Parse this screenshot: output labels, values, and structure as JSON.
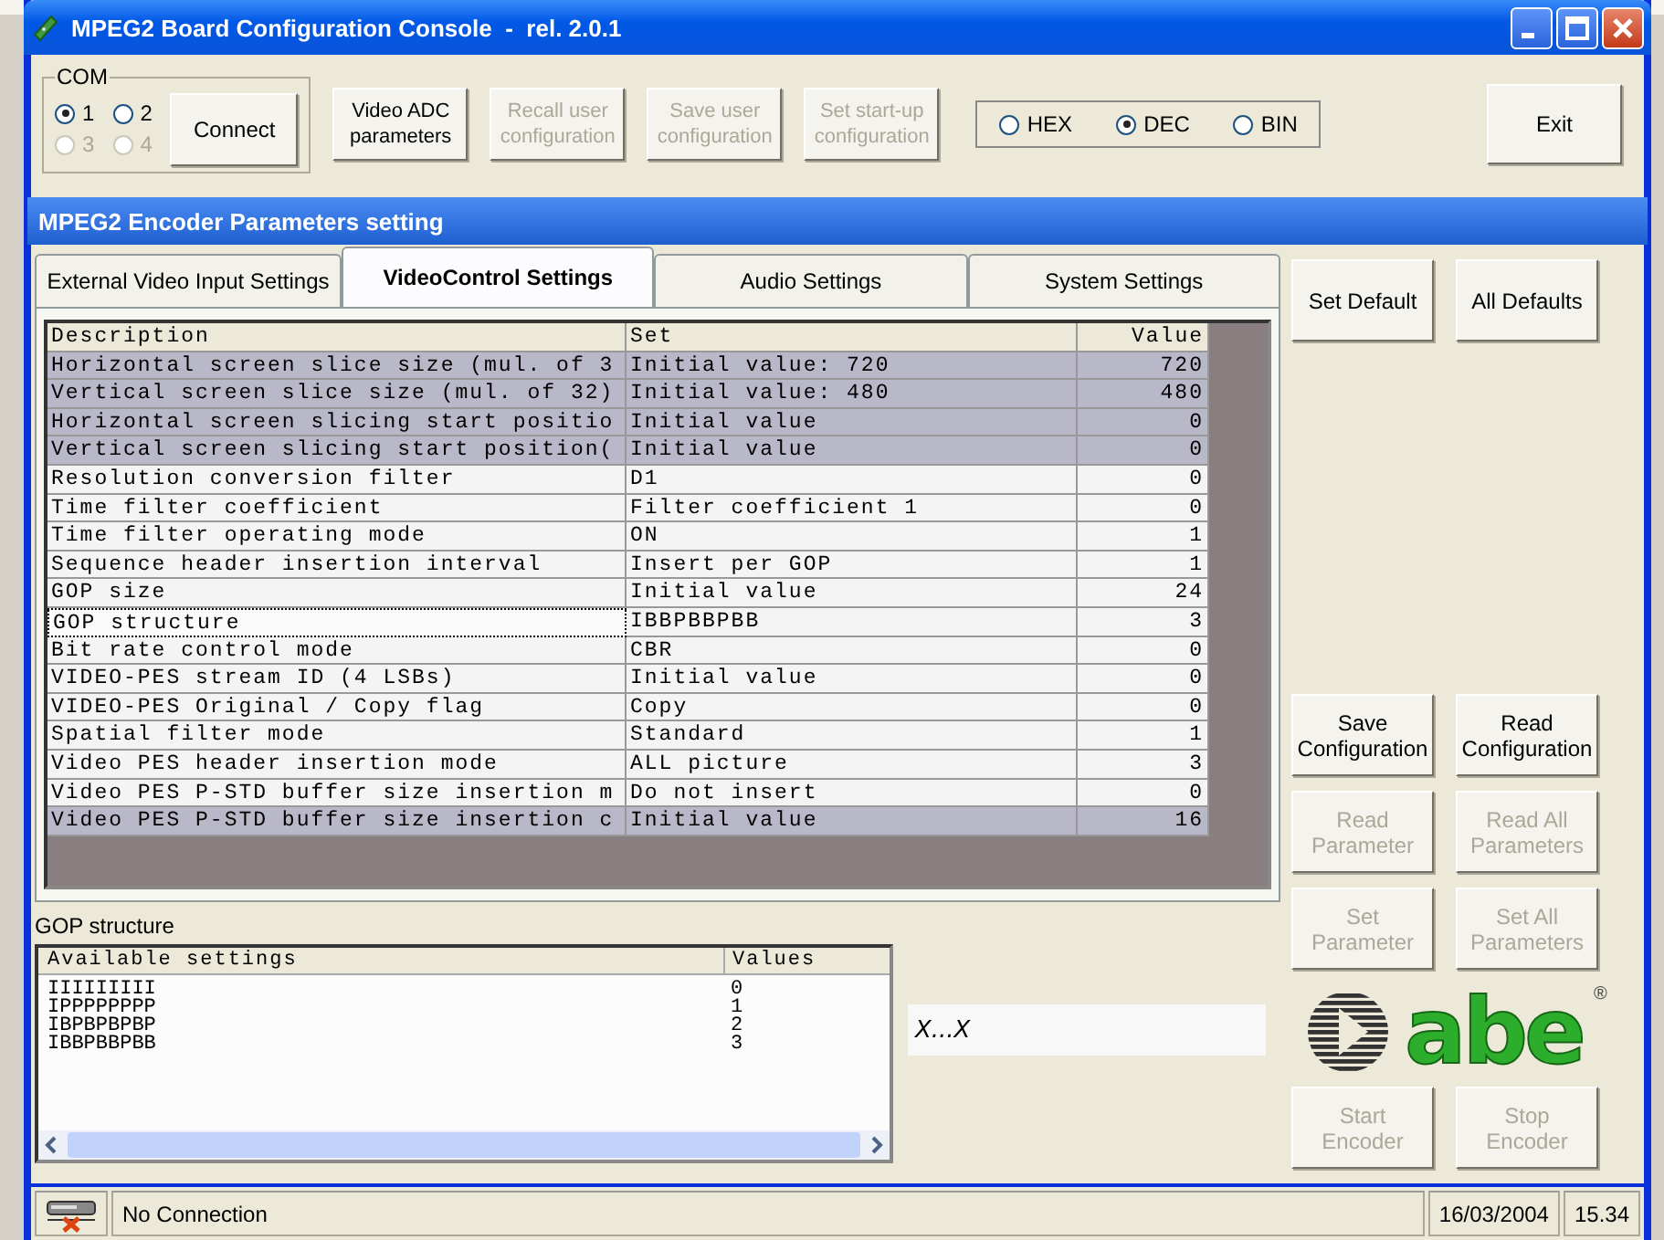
{
  "window": {
    "title": "MPEG2 Board Configuration Console  -  rel. 2.0.1"
  },
  "com": {
    "label": "COM",
    "ports": [
      {
        "label": "1",
        "selected": true,
        "disabled": false
      },
      {
        "label": "2",
        "selected": false,
        "disabled": false
      },
      {
        "label": "3",
        "selected": false,
        "disabled": true
      },
      {
        "label": "4",
        "selected": false,
        "disabled": true
      }
    ]
  },
  "toolbar_buttons": [
    {
      "label": "Connect",
      "disabled": false
    },
    {
      "label": "Video ADC parameters",
      "disabled": false
    },
    {
      "label": "Recall user configuration",
      "disabled": true
    },
    {
      "label": "Save user configuration",
      "disabled": true
    },
    {
      "label": "Set start-up configuration",
      "disabled": true
    }
  ],
  "format": [
    {
      "label": "HEX",
      "selected": false
    },
    {
      "label": "DEC",
      "selected": true
    },
    {
      "label": "BIN",
      "selected": false
    }
  ],
  "exit_button": "Exit",
  "inner_window": {
    "title": "MPEG2 Encoder Parameters setting"
  },
  "tabs": [
    {
      "label": "External Video Input Settings",
      "selected": false
    },
    {
      "label": "VideoControl Settings",
      "selected": true
    },
    {
      "label": "Audio Settings",
      "selected": false
    },
    {
      "label": "System Settings",
      "selected": false
    }
  ],
  "table": {
    "columns": [
      "Description",
      "Set",
      "Value"
    ],
    "rows": [
      {
        "cells": [
          "Horizontal screen slice size (mul. of 3",
          "Initial value: 720",
          "720"
        ],
        "selected": true,
        "focused": false
      },
      {
        "cells": [
          "Vertical screen slice size (mul. of 32)",
          "Initial value: 480",
          "480"
        ],
        "selected": true,
        "focused": false
      },
      {
        "cells": [
          "Horizontal screen slicing start positio",
          "Initial value",
          "0"
        ],
        "selected": true,
        "focused": false
      },
      {
        "cells": [
          "Vertical screen slicing start position(",
          "Initial value",
          "0"
        ],
        "selected": true,
        "focused": false
      },
      {
        "cells": [
          "Resolution conversion filter",
          "D1",
          "0"
        ],
        "selected": false,
        "focused": false
      },
      {
        "cells": [
          "Time filter coefficient",
          "Filter coefficient 1",
          "0"
        ],
        "selected": false,
        "focused": false
      },
      {
        "cells": [
          "Time filter operating mode",
          "ON",
          "1"
        ],
        "selected": false,
        "focused": false
      },
      {
        "cells": [
          "Sequence header insertion interval",
          "Insert per GOP",
          "1"
        ],
        "selected": false,
        "focused": false
      },
      {
        "cells": [
          "GOP size",
          "Initial value",
          "24"
        ],
        "selected": false,
        "focused": false
      },
      {
        "cells": [
          "GOP structure",
          "IBBPBBPBB",
          "3"
        ],
        "selected": false,
        "focused": true
      },
      {
        "cells": [
          "Bit rate control mode",
          "CBR",
          "0"
        ],
        "selected": false,
        "focused": false
      },
      {
        "cells": [
          "VIDEO-PES stream ID (4 LSBs)",
          "Initial value",
          "0"
        ],
        "selected": false,
        "focused": false
      },
      {
        "cells": [
          "VIDEO-PES Original / Copy flag",
          "Copy",
          "0"
        ],
        "selected": false,
        "focused": false
      },
      {
        "cells": [
          "Spatial filter mode",
          "Standard",
          "1"
        ],
        "selected": false,
        "focused": false
      },
      {
        "cells": [
          "Video PES header insertion mode",
          "ALL picture",
          "3"
        ],
        "selected": false,
        "focused": false
      },
      {
        "cells": [
          "Video PES P-STD buffer size insertion m",
          "Do not insert",
          "0"
        ],
        "selected": false,
        "focused": false
      },
      {
        "cells": [
          "Video PES P-STD buffer size insertion c",
          "Initial value",
          "16"
        ],
        "selected": true,
        "focused": false
      }
    ]
  },
  "side_buttons": [
    {
      "label": "Set Default",
      "disabled": false
    },
    {
      "label": "All Defaults",
      "disabled": false
    },
    {
      "label": "Save Configuration",
      "disabled": false
    },
    {
      "label": "Read Configuration",
      "disabled": false
    },
    {
      "label": "Read Parameter",
      "disabled": true
    },
    {
      "label": "Read All Parameters",
      "disabled": true
    },
    {
      "label": "Set Parameter",
      "disabled": true
    },
    {
      "label": "Set All Parameters",
      "disabled": true
    }
  ],
  "logo": {
    "text": "abe",
    "mark": "®"
  },
  "encoder_buttons": [
    {
      "label": "Start Encoder",
      "disabled": true
    },
    {
      "label": "Stop Encoder",
      "disabled": true
    }
  ],
  "gop": {
    "label": "GOP structure",
    "columns": [
      "Available settings",
      "Values"
    ],
    "rows": [
      [
        "IIIIIIIII",
        "0"
      ],
      [
        "IPPPPPPPP",
        "1"
      ],
      [
        "IBPBPBPBP",
        "2"
      ],
      [
        "IBBPBBPBB",
        "3"
      ]
    ],
    "pattern": "X...X"
  },
  "status_bar": {
    "message": "No Connection",
    "date": "16/03/2004",
    "time": "15.34"
  }
}
